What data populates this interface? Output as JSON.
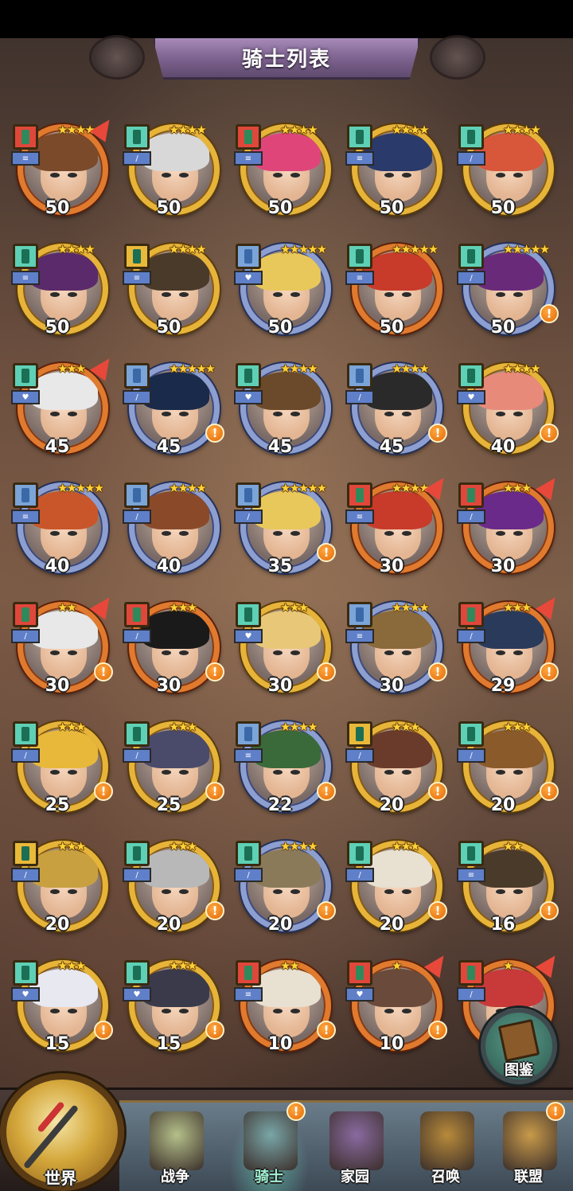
{
  "title": "骑士列表",
  "knights": [
    {
      "level": "50",
      "stars": "★★★★",
      "frame": "orange",
      "cls": "red",
      "upgrade": true,
      "alert": false,
      "hair": "#7a4a2a",
      "role": "≡"
    },
    {
      "level": "50",
      "stars": "★★★★",
      "frame": "gold",
      "cls": "teal",
      "upgrade": false,
      "alert": false,
      "hair": "#d8d8d8",
      "role": "/"
    },
    {
      "level": "50",
      "stars": "★★★★",
      "frame": "gold",
      "cls": "red",
      "upgrade": false,
      "alert": false,
      "hair": "#e0457a",
      "role": "≡"
    },
    {
      "level": "50",
      "stars": "★★★★",
      "frame": "gold",
      "cls": "teal",
      "upgrade": false,
      "alert": false,
      "hair": "#2a3a6a",
      "role": "≡"
    },
    {
      "level": "50",
      "stars": "★★★★",
      "frame": "gold",
      "cls": "teal",
      "upgrade": false,
      "alert": false,
      "hair": "#d8563a",
      "role": "/"
    },
    {
      "level": "50",
      "stars": "★★★★",
      "frame": "gold",
      "cls": "teal",
      "upgrade": false,
      "alert": false,
      "hair": "#5a2a6a",
      "role": "≡"
    },
    {
      "level": "50",
      "stars": "★★★★",
      "frame": "gold",
      "cls": "gold",
      "upgrade": false,
      "alert": false,
      "hair": "#4a3a2a",
      "role": "≡"
    },
    {
      "level": "50",
      "stars": "★★★★★",
      "frame": "blue",
      "cls": "blue",
      "upgrade": false,
      "alert": false,
      "hair": "#e8c85a",
      "role": "♥"
    },
    {
      "level": "50",
      "stars": "★★★★★",
      "frame": "orange",
      "cls": "teal",
      "upgrade": false,
      "alert": false,
      "hair": "#c83a2a",
      "role": "≡"
    },
    {
      "level": "50",
      "stars": "★★★★★",
      "frame": "blue",
      "cls": "teal",
      "upgrade": false,
      "alert": true,
      "hair": "#6a2a7a",
      "role": "/"
    },
    {
      "level": "45",
      "stars": "★★★",
      "frame": "orange",
      "cls": "teal",
      "upgrade": true,
      "alert": false,
      "hair": "#e8e8e8",
      "role": "♥"
    },
    {
      "level": "45",
      "stars": "★★★★★",
      "frame": "blue",
      "cls": "blue",
      "upgrade": false,
      "alert": true,
      "hair": "#1a2a4a",
      "role": "/"
    },
    {
      "level": "45",
      "stars": "★★★★",
      "frame": "blue",
      "cls": "teal",
      "upgrade": false,
      "alert": false,
      "hair": "#6a4a2a",
      "role": "♥"
    },
    {
      "level": "45",
      "stars": "★★★★",
      "frame": "blue",
      "cls": "blue",
      "upgrade": false,
      "alert": true,
      "hair": "#2a2a2a",
      "role": "/"
    },
    {
      "level": "40",
      "stars": "★★★★",
      "frame": "gold",
      "cls": "teal",
      "upgrade": false,
      "alert": true,
      "hair": "#e88a7a",
      "role": "♥"
    },
    {
      "level": "40",
      "stars": "★★★★★",
      "frame": "blue",
      "cls": "blue",
      "upgrade": false,
      "alert": false,
      "hair": "#c8562a",
      "role": "≡"
    },
    {
      "level": "40",
      "stars": "★★★★",
      "frame": "blue",
      "cls": "blue",
      "upgrade": false,
      "alert": false,
      "hair": "#8a4a2a",
      "role": "/"
    },
    {
      "level": "35",
      "stars": "★★★★★",
      "frame": "blue",
      "cls": "blue",
      "upgrade": false,
      "alert": true,
      "hair": "#e8c85a",
      "role": "/"
    },
    {
      "level": "30",
      "stars": "★★★★",
      "frame": "orange",
      "cls": "red",
      "upgrade": true,
      "alert": false,
      "hair": "#c83a2a",
      "role": "≡"
    },
    {
      "level": "30",
      "stars": "★★★",
      "frame": "orange",
      "cls": "red",
      "upgrade": true,
      "alert": false,
      "hair": "#6a2a8a",
      "role": "/"
    },
    {
      "level": "30",
      "stars": "★★",
      "frame": "orange",
      "cls": "red",
      "upgrade": true,
      "alert": true,
      "hair": "#e8e8e8",
      "role": "/"
    },
    {
      "level": "30",
      "stars": "★★★",
      "frame": "orange",
      "cls": "red",
      "upgrade": false,
      "alert": true,
      "hair": "#1a1a1a",
      "role": "/"
    },
    {
      "level": "30",
      "stars": "★★★",
      "frame": "gold",
      "cls": "teal",
      "upgrade": false,
      "alert": true,
      "hair": "#e8c878",
      "role": "♥"
    },
    {
      "level": "30",
      "stars": "★★★★",
      "frame": "blue",
      "cls": "blue",
      "upgrade": false,
      "alert": true,
      "hair": "#8a6a3a",
      "role": "≡"
    },
    {
      "level": "29",
      "stars": "★★★",
      "frame": "orange",
      "cls": "red",
      "upgrade": true,
      "alert": true,
      "hair": "#2a3a5a",
      "role": "/"
    },
    {
      "level": "25",
      "stars": "★★★",
      "frame": "gold",
      "cls": "teal",
      "upgrade": false,
      "alert": true,
      "hair": "#e8b83a",
      "role": "/"
    },
    {
      "level": "25",
      "stars": "★★★",
      "frame": "gold",
      "cls": "teal",
      "upgrade": false,
      "alert": true,
      "hair": "#4a4a6a",
      "role": "/"
    },
    {
      "level": "22",
      "stars": "★★★★",
      "frame": "blue",
      "cls": "blue",
      "upgrade": false,
      "alert": true,
      "hair": "#3a6a3a",
      "role": "≡"
    },
    {
      "level": "20",
      "stars": "★★★",
      "frame": "gold",
      "cls": "gold",
      "upgrade": false,
      "alert": true,
      "hair": "#6a3a2a",
      "role": "/"
    },
    {
      "level": "20",
      "stars": "★★★",
      "frame": "gold",
      "cls": "teal",
      "upgrade": false,
      "alert": true,
      "hair": "#8a5a2a",
      "role": "/"
    },
    {
      "level": "20",
      "stars": "★★★",
      "frame": "gold",
      "cls": "gold",
      "upgrade": false,
      "alert": false,
      "hair": "#c8a040",
      "role": "/"
    },
    {
      "level": "20",
      "stars": "★★★",
      "frame": "gold",
      "cls": "teal",
      "upgrade": false,
      "alert": true,
      "hair": "#b8b8b8",
      "role": "/"
    },
    {
      "level": "20",
      "stars": "★★★★",
      "frame": "blue",
      "cls": "teal",
      "upgrade": false,
      "alert": true,
      "hair": "#8a7a5a",
      "role": "/"
    },
    {
      "level": "20",
      "stars": "★★★",
      "frame": "gold",
      "cls": "teal",
      "upgrade": false,
      "alert": true,
      "hair": "#e8e0d0",
      "role": "/"
    },
    {
      "level": "16",
      "stars": "★★",
      "frame": "gold",
      "cls": "teal",
      "upgrade": false,
      "alert": true,
      "hair": "#4a3a2a",
      "role": "≡"
    },
    {
      "level": "15",
      "stars": "★★★",
      "frame": "gold",
      "cls": "teal",
      "upgrade": false,
      "alert": true,
      "hair": "#e8e8f0",
      "role": "♥"
    },
    {
      "level": "15",
      "stars": "★★★",
      "frame": "gold",
      "cls": "teal",
      "upgrade": false,
      "alert": true,
      "hair": "#3a3a4a",
      "role": "♥"
    },
    {
      "level": "10",
      "stars": "★★",
      "frame": "orange",
      "cls": "red",
      "upgrade": false,
      "alert": true,
      "hair": "#e8e0d0",
      "role": "≡"
    },
    {
      "level": "10",
      "stars": "★",
      "frame": "orange",
      "cls": "red",
      "upgrade": true,
      "alert": true,
      "hair": "#6a4a3a",
      "role": "♥"
    },
    {
      "level": "",
      "stars": "★",
      "frame": "orange",
      "cls": "red",
      "upgrade": true,
      "alert": false,
      "hair": "#c83a3a",
      "role": "/"
    }
  ],
  "codex_label": "图鉴",
  "alert_glyph": "!",
  "nav": {
    "world_label": "世界",
    "items": [
      {
        "label": "战争",
        "color": "#b5c08a",
        "alert": false,
        "active": false
      },
      {
        "label": "骑士",
        "color": "#7aa6a8",
        "alert": true,
        "active": true
      },
      {
        "label": "家园",
        "color": "#8a6aa0",
        "alert": false,
        "active": false
      },
      {
        "label": "召唤",
        "color": "#b88a3a",
        "alert": false,
        "active": false
      },
      {
        "label": "联盟",
        "color": "#c89a4a",
        "alert": true,
        "active": false
      }
    ]
  }
}
